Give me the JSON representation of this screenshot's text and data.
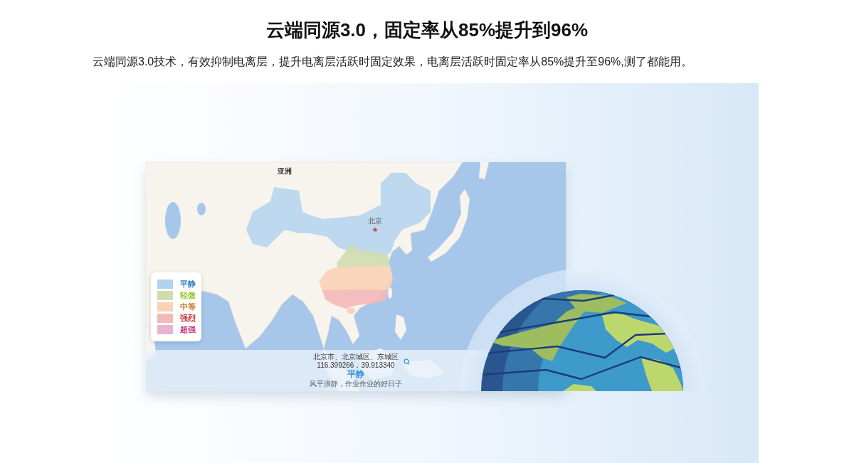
{
  "title": "云端同源3.0，固定率从85%提升到96%",
  "description": "云端同源3.0技术，有效抑制电离层，提升电离层活跃时固定效果，电离层活跃时固定率从85%提升至96%,测了都能用。",
  "map": {
    "region_label": "亚洲",
    "city_label": "北京",
    "legend": [
      {
        "label": "平静",
        "color": "#b3d2ee"
      },
      {
        "label": "轻微",
        "color": "#cfddb0"
      },
      {
        "label": "中等",
        "color": "#f8d3b5"
      },
      {
        "label": "强烈",
        "color": "#f4b8b8"
      },
      {
        "label": "超强",
        "color": "#e8b3cf"
      }
    ],
    "info": {
      "location": "北京市、北京城区、东城区",
      "coordinates": "116.399266，39.913340",
      "status": "平静",
      "note": "风平浪静，作业作业的好日子"
    }
  }
}
